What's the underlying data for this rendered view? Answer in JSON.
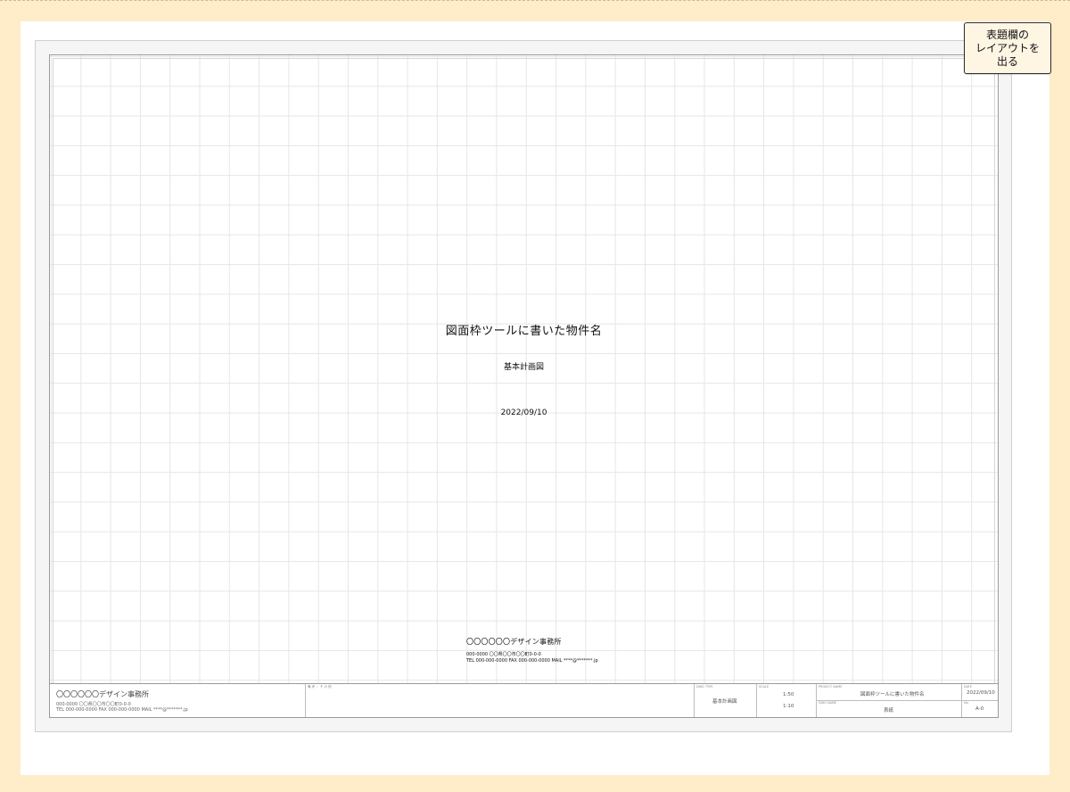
{
  "toolbar": {
    "layout_button_line1": "表題欄の",
    "layout_button_line2": "レイアウトを",
    "layout_button_line3": "出る"
  },
  "sheet": {
    "project_title": "図面枠ツールに書いた物件名",
    "drawing_name": "基本計画図",
    "date": "2022/09/10",
    "office": {
      "name": "〇〇〇〇〇〇デザイン事務所",
      "address_line1": "000-0000 〇〇県〇〇市〇〇町0-0-0",
      "address_line2": "TEL 000-000-0000 FAX 000-000-0000 MAIL ****@*******.jp"
    }
  },
  "title_block": {
    "office_name": "〇〇〇〇〇〇デザイン事務所",
    "office_address_line1": "000-0000 〇〇県〇〇市〇〇町0-0-0",
    "office_address_line2": "TEL 000-000-0000 FAX 000-000-0000 MAIL ****@*******.jp",
    "notes_label": "備 考 ・ そ の 他",
    "drawing_type_label": "DWG TYPE",
    "drawing_type": "基本計画図",
    "scale_label": "SCALE",
    "scale_1": "1:50",
    "scale_2": "1:10",
    "project_name_label": "PROJECT NAME",
    "project_name": "図面枠ツールに書いた物件名",
    "dwg_name_label": "DWG NAME",
    "dwg_name": "表紙",
    "date_label": "DATE",
    "date": "2022/09/10",
    "no_label": "No.",
    "no": "A-0"
  }
}
